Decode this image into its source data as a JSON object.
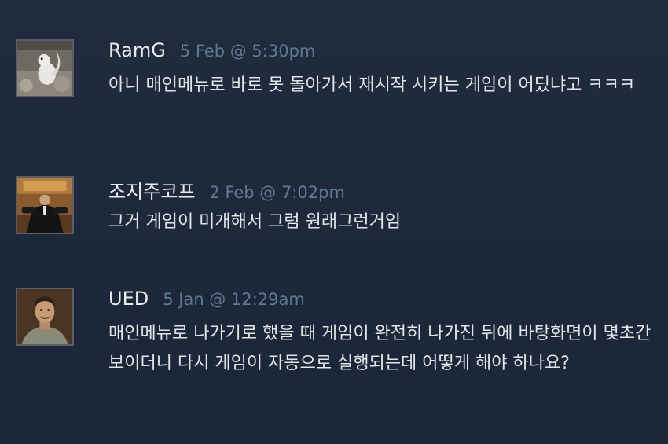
{
  "comments": [
    {
      "author": "RamG",
      "timestamp": "5 Feb @ 5:30pm",
      "text": "아니 매인메뉴로 바로 못 돌아가서 재시작 시키는 게임이 어딨냐고 ㅋㅋㅋ",
      "avatar_icon": "squirrel-avatar-icon"
    },
    {
      "author": "조지주코프",
      "timestamp": "2 Feb @ 7:02pm",
      "text": "그거 게임이 미개해서 그럼 원래그런거임",
      "avatar_icon": "suited-figure-avatar-icon"
    },
    {
      "author": "UED",
      "timestamp": "5 Jan @ 12:29am",
      "text": "매인메뉴로 나가기로 했을 때 게임이 완전히 나가진 뒤에 바탕화면이 몇초간 보이더니 다시 게임이 자동으로 실행되는데 어떻게 해야 하나요?",
      "avatar_icon": "portrait-avatar-icon"
    }
  ],
  "colors": {
    "background": "#1e2a3c",
    "author": "#e8ecef",
    "timestamp": "#5e7a93",
    "text": "#e3e6e9",
    "avatar_border": "#5a5f66"
  }
}
